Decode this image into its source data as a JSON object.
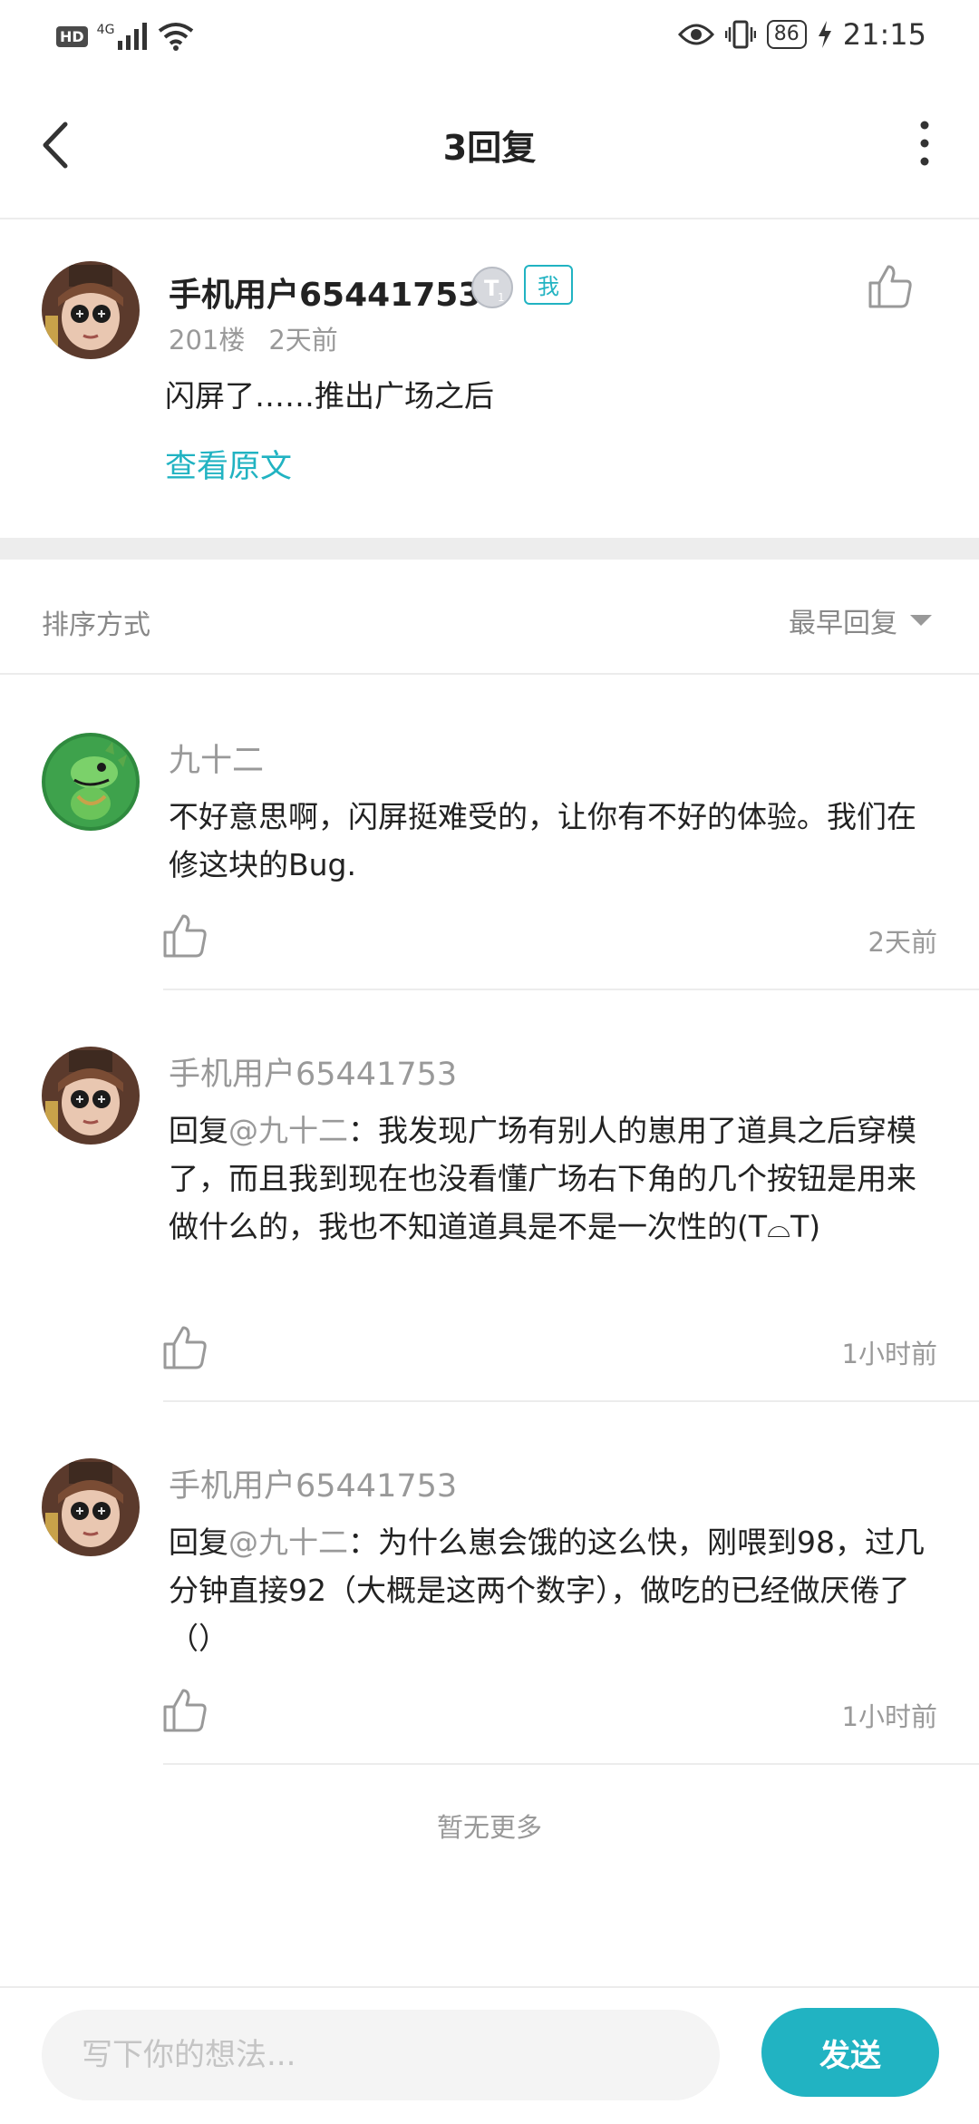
{
  "status_bar": {
    "hd": "HD",
    "network": "4G",
    "battery": "86",
    "time": "21:15",
    "icons": [
      "signal-icon",
      "wifi-icon",
      "eye-icon",
      "vibrate-icon",
      "battery-icon",
      "charging-icon"
    ]
  },
  "header": {
    "title": "3回复",
    "back_icon": "back-arrow-icon",
    "more_icon": "more-vertical-icon"
  },
  "original_post": {
    "author": "手机用户65441753",
    "me_badge": "我",
    "floor": "201楼",
    "time": "2天前",
    "content": "闪屏了……推出广场之后",
    "view_original": "查看原文"
  },
  "sort": {
    "label": "排序方式",
    "value": "最早回复"
  },
  "replies": [
    {
      "author": "九十二",
      "prefix": "",
      "mention": "",
      "sep": "",
      "text": "不好意思啊，闪屏挺难受的，让你有不好的体验。我们在修这块的Bug.",
      "time": "2天前"
    },
    {
      "author": "手机用户65441753",
      "prefix": "回复",
      "mention": "@九十二",
      "sep": "：",
      "text": "我发现广场有别人的崽用了道具之后穿模了，而且我到现在也没看懂广场右下角的几个按钮是用来做什么的，我也不知道道具是不是一次性的(T⌓T)",
      "time": "1小时前"
    },
    {
      "author": "手机用户65441753",
      "prefix": "回复",
      "mention": "@九十二",
      "sep": "：",
      "text": "为什么崽会饿的这么快，刚喂到98，过几分钟直接92（大概是这两个数字），做吃的已经做厌倦了（）",
      "time": "1小时前"
    }
  ],
  "no_more": "暂无更多",
  "composer": {
    "placeholder": "写下你的想法...",
    "send": "发送"
  },
  "colors": {
    "accent": "#21b3c2",
    "text": "#222222",
    "muted": "#999999",
    "divider": "#ececec"
  }
}
